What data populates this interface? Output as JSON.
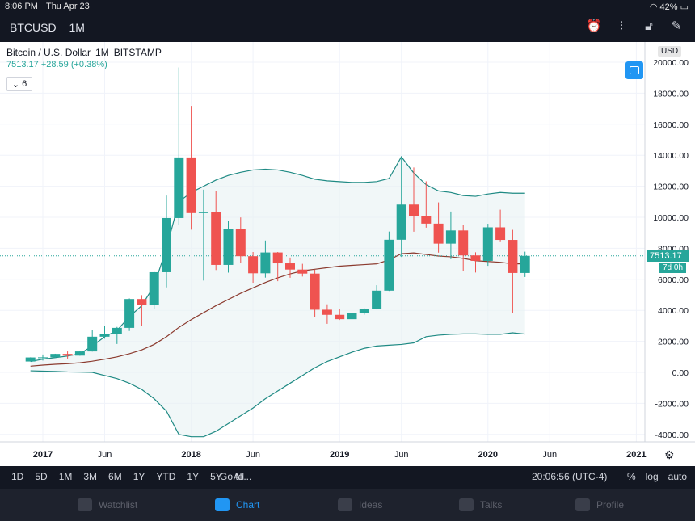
{
  "status": {
    "time": "8:06 PM",
    "date": "Thu Apr 23",
    "battery": "42%"
  },
  "header": {
    "symbol": "BTCUSD",
    "interval": "1M"
  },
  "toolbar_icons": [
    "alarm-icon",
    "indicators-icon",
    "lock-icon",
    "drawing-icon"
  ],
  "legend": {
    "title": "Bitcoin / U.S. Dollar",
    "interval": "1M",
    "exchange": "BITSTAMP",
    "last": "7513.17",
    "change": "+28.59 (+0.38%)",
    "indicator_count": "6"
  },
  "currency": "USD",
  "price_label": "7513.17",
  "time_label": "7d 0h",
  "range_buttons": [
    "1D",
    "5D",
    "1M",
    "3M",
    "6M",
    "1Y",
    "YTD",
    "1Y",
    "5Y",
    "All"
  ],
  "goto": "Go to...",
  "clock": "20:06:56 (UTC-4)",
  "options": [
    "%",
    "log",
    "auto"
  ],
  "tabs": [
    "Watchlist",
    "Chart",
    "Ideas",
    "Talks",
    "Profile"
  ],
  "colors": {
    "up": "#26a69a",
    "down": "#ef5350",
    "band": "#1f8a84",
    "ma": "#8b3a2e"
  },
  "chart_data": {
    "type": "candlestick",
    "y_ticks": [
      "20000.00",
      "18000.00",
      "16000.00",
      "14000.00",
      "12000.00",
      "10000.00",
      "8000.00",
      "6000.00",
      "4000.00",
      "2000.00",
      "0.00",
      "-2000.00",
      "-4000.00"
    ],
    "ylim": [
      -4500,
      20500
    ],
    "x_ticks": [
      "2017",
      "Jun",
      "2018",
      "Jun",
      "2019",
      "Jun",
      "2020",
      "Jun",
      "2021"
    ],
    "candles": [
      {
        "t": "2016-12",
        "o": 700,
        "h": 970,
        "l": 700,
        "c": 960
      },
      {
        "t": "2017-01",
        "o": 960,
        "h": 1150,
        "l": 760,
        "c": 970
      },
      {
        "t": "2017-02",
        "o": 970,
        "h": 1200,
        "l": 930,
        "c": 1190
      },
      {
        "t": "2017-03",
        "o": 1190,
        "h": 1350,
        "l": 890,
        "c": 1080
      },
      {
        "t": "2017-04",
        "o": 1080,
        "h": 1360,
        "l": 1070,
        "c": 1350
      },
      {
        "t": "2017-05",
        "o": 1350,
        "h": 2760,
        "l": 1340,
        "c": 2300
      },
      {
        "t": "2017-06",
        "o": 2300,
        "h": 3000,
        "l": 2170,
        "c": 2490
      },
      {
        "t": "2017-07",
        "o": 2490,
        "h": 2930,
        "l": 1830,
        "c": 2870
      },
      {
        "t": "2017-08",
        "o": 2870,
        "h": 4770,
        "l": 2670,
        "c": 4730
      },
      {
        "t": "2017-09",
        "o": 4730,
        "h": 4980,
        "l": 2980,
        "c": 4340
      },
      {
        "t": "2017-10",
        "o": 4340,
        "h": 6480,
        "l": 4110,
        "c": 6460
      },
      {
        "t": "2017-11",
        "o": 6460,
        "h": 11400,
        "l": 5480,
        "c": 9950
      },
      {
        "t": "2017-12",
        "o": 9950,
        "h": 19660,
        "l": 9500,
        "c": 13860
      },
      {
        "t": "2018-01",
        "o": 13860,
        "h": 17180,
        "l": 9200,
        "c": 10270
      },
      {
        "t": "2018-02",
        "o": 10270,
        "h": 11780,
        "l": 5920,
        "c": 10330
      },
      {
        "t": "2018-03",
        "o": 10330,
        "h": 11700,
        "l": 6600,
        "c": 6930
      },
      {
        "t": "2018-04",
        "o": 6930,
        "h": 9760,
        "l": 6430,
        "c": 9240
      },
      {
        "t": "2018-05",
        "o": 9240,
        "h": 9990,
        "l": 7030,
        "c": 7490
      },
      {
        "t": "2018-06",
        "o": 7490,
        "h": 7760,
        "l": 5780,
        "c": 6390
      },
      {
        "t": "2018-07",
        "o": 6390,
        "h": 8500,
        "l": 6110,
        "c": 7730
      },
      {
        "t": "2018-08",
        "o": 7730,
        "h": 7760,
        "l": 5880,
        "c": 7030
      },
      {
        "t": "2018-09",
        "o": 7030,
        "h": 7400,
        "l": 6100,
        "c": 6630
      },
      {
        "t": "2018-10",
        "o": 6630,
        "h": 7000,
        "l": 6180,
        "c": 6370
      },
      {
        "t": "2018-11",
        "o": 6370,
        "h": 6620,
        "l": 3550,
        "c": 4040
      },
      {
        "t": "2018-12",
        "o": 4040,
        "h": 4390,
        "l": 3130,
        "c": 3710
      },
      {
        "t": "2019-01",
        "o": 3710,
        "h": 4080,
        "l": 3380,
        "c": 3430
      },
      {
        "t": "2019-02",
        "o": 3430,
        "h": 4200,
        "l": 3390,
        "c": 3820
      },
      {
        "t": "2019-03",
        "o": 3820,
        "h": 4130,
        "l": 3720,
        "c": 4100
      },
      {
        "t": "2019-04",
        "o": 4100,
        "h": 5620,
        "l": 4060,
        "c": 5270
      },
      {
        "t": "2019-05",
        "o": 5270,
        "h": 9080,
        "l": 5250,
        "c": 8550
      },
      {
        "t": "2019-06",
        "o": 8550,
        "h": 13880,
        "l": 7440,
        "c": 10820
      },
      {
        "t": "2019-07",
        "o": 10820,
        "h": 13210,
        "l": 9070,
        "c": 10090
      },
      {
        "t": "2019-08",
        "o": 10090,
        "h": 12320,
        "l": 9330,
        "c": 9590
      },
      {
        "t": "2019-09",
        "o": 9590,
        "h": 10960,
        "l": 7720,
        "c": 8300
      },
      {
        "t": "2019-10",
        "o": 8300,
        "h": 10370,
        "l": 7300,
        "c": 9150
      },
      {
        "t": "2019-11",
        "o": 9150,
        "h": 9500,
        "l": 6520,
        "c": 7540
      },
      {
        "t": "2019-12",
        "o": 7540,
        "h": 7740,
        "l": 6440,
        "c": 7190
      },
      {
        "t": "2020-01",
        "o": 7190,
        "h": 9580,
        "l": 6870,
        "c": 9350
      },
      {
        "t": "2020-02",
        "o": 9350,
        "h": 10490,
        "l": 8450,
        "c": 8540
      },
      {
        "t": "2020-03",
        "o": 8540,
        "h": 9190,
        "l": 3850,
        "c": 6410
      },
      {
        "t": "2020-04",
        "o": 6410,
        "h": 7780,
        "l": 6150,
        "c": 7513
      }
    ],
    "bb_upper": [
      {
        "t": "2016-12",
        "v": 700
      },
      {
        "t": "2017-01",
        "v": 850
      },
      {
        "t": "2017-02",
        "v": 950
      },
      {
        "t": "2017-03",
        "v": 1050
      },
      {
        "t": "2017-04",
        "v": 1200
      },
      {
        "t": "2017-05",
        "v": 1700
      },
      {
        "t": "2017-06",
        "v": 2300
      },
      {
        "t": "2017-07",
        "v": 2700
      },
      {
        "t": "2017-08",
        "v": 3600
      },
      {
        "t": "2017-09",
        "v": 4300
      },
      {
        "t": "2017-10",
        "v": 5600
      },
      {
        "t": "2017-11",
        "v": 8000
      },
      {
        "t": "2017-12",
        "v": 11000
      },
      {
        "t": "2018-01",
        "v": 11600
      },
      {
        "t": "2018-02",
        "v": 12000
      },
      {
        "t": "2018-03",
        "v": 12400
      },
      {
        "t": "2018-04",
        "v": 12700
      },
      {
        "t": "2018-05",
        "v": 12900
      },
      {
        "t": "2018-06",
        "v": 13050
      },
      {
        "t": "2018-07",
        "v": 13100
      },
      {
        "t": "2018-08",
        "v": 13050
      },
      {
        "t": "2018-09",
        "v": 12900
      },
      {
        "t": "2018-10",
        "v": 12700
      },
      {
        "t": "2018-11",
        "v": 12450
      },
      {
        "t": "2018-12",
        "v": 12350
      },
      {
        "t": "2019-01",
        "v": 12300
      },
      {
        "t": "2019-02",
        "v": 12250
      },
      {
        "t": "2019-03",
        "v": 12250
      },
      {
        "t": "2019-04",
        "v": 12300
      },
      {
        "t": "2019-05",
        "v": 12500
      },
      {
        "t": "2019-06",
        "v": 13900
      },
      {
        "t": "2019-07",
        "v": 12850
      },
      {
        "t": "2019-08",
        "v": 12100
      },
      {
        "t": "2019-09",
        "v": 11700
      },
      {
        "t": "2019-10",
        "v": 11600
      },
      {
        "t": "2019-11",
        "v": 11400
      },
      {
        "t": "2019-12",
        "v": 11350
      },
      {
        "t": "2020-01",
        "v": 11500
      },
      {
        "t": "2020-02",
        "v": 11600
      },
      {
        "t": "2020-03",
        "v": 11550
      },
      {
        "t": "2020-04",
        "v": 11550
      }
    ],
    "bb_lower": [
      {
        "t": "2016-12",
        "v": 100
      },
      {
        "t": "2017-01",
        "v": 80
      },
      {
        "t": "2017-02",
        "v": 60
      },
      {
        "t": "2017-03",
        "v": 30
      },
      {
        "t": "2017-04",
        "v": 20
      },
      {
        "t": "2017-05",
        "v": 0
      },
      {
        "t": "2017-06",
        "v": -200
      },
      {
        "t": "2017-07",
        "v": -400
      },
      {
        "t": "2017-08",
        "v": -700
      },
      {
        "t": "2017-09",
        "v": -1100
      },
      {
        "t": "2017-10",
        "v": -1700
      },
      {
        "t": "2017-11",
        "v": -2500
      },
      {
        "t": "2017-12",
        "v": -4000
      },
      {
        "t": "2018-01",
        "v": -4150
      },
      {
        "t": "2018-02",
        "v": -4150
      },
      {
        "t": "2018-03",
        "v": -3800
      },
      {
        "t": "2018-04",
        "v": -3300
      },
      {
        "t": "2018-05",
        "v": -2800
      },
      {
        "t": "2018-06",
        "v": -2300
      },
      {
        "t": "2018-07",
        "v": -1700
      },
      {
        "t": "2018-08",
        "v": -1200
      },
      {
        "t": "2018-09",
        "v": -700
      },
      {
        "t": "2018-10",
        "v": -200
      },
      {
        "t": "2018-11",
        "v": 300
      },
      {
        "t": "2018-12",
        "v": 700
      },
      {
        "t": "2019-01",
        "v": 1000
      },
      {
        "t": "2019-02",
        "v": 1300
      },
      {
        "t": "2019-03",
        "v": 1550
      },
      {
        "t": "2019-04",
        "v": 1700
      },
      {
        "t": "2019-05",
        "v": 1750
      },
      {
        "t": "2019-06",
        "v": 1800
      },
      {
        "t": "2019-07",
        "v": 1900
      },
      {
        "t": "2019-08",
        "v": 2300
      },
      {
        "t": "2019-09",
        "v": 2400
      },
      {
        "t": "2019-10",
        "v": 2450
      },
      {
        "t": "2019-11",
        "v": 2480
      },
      {
        "t": "2019-12",
        "v": 2480
      },
      {
        "t": "2020-01",
        "v": 2450
      },
      {
        "t": "2020-02",
        "v": 2450
      },
      {
        "t": "2020-03",
        "v": 2550
      },
      {
        "t": "2020-04",
        "v": 2470
      }
    ],
    "ma": [
      {
        "t": "2016-12",
        "v": 400
      },
      {
        "t": "2017-01",
        "v": 470
      },
      {
        "t": "2017-02",
        "v": 520
      },
      {
        "t": "2017-03",
        "v": 560
      },
      {
        "t": "2017-04",
        "v": 620
      },
      {
        "t": "2017-05",
        "v": 720
      },
      {
        "t": "2017-06",
        "v": 850
      },
      {
        "t": "2017-07",
        "v": 1000
      },
      {
        "t": "2017-08",
        "v": 1200
      },
      {
        "t": "2017-09",
        "v": 1450
      },
      {
        "t": "2017-10",
        "v": 1800
      },
      {
        "t": "2017-11",
        "v": 2300
      },
      {
        "t": "2017-12",
        "v": 2900
      },
      {
        "t": "2018-01",
        "v": 3400
      },
      {
        "t": "2018-02",
        "v": 3850
      },
      {
        "t": "2018-03",
        "v": 4300
      },
      {
        "t": "2018-04",
        "v": 4700
      },
      {
        "t": "2018-05",
        "v": 5100
      },
      {
        "t": "2018-06",
        "v": 5450
      },
      {
        "t": "2018-07",
        "v": 5800
      },
      {
        "t": "2018-08",
        "v": 6100
      },
      {
        "t": "2018-09",
        "v": 6350
      },
      {
        "t": "2018-10",
        "v": 6550
      },
      {
        "t": "2018-11",
        "v": 6650
      },
      {
        "t": "2018-12",
        "v": 6750
      },
      {
        "t": "2019-01",
        "v": 6850
      },
      {
        "t": "2019-02",
        "v": 6900
      },
      {
        "t": "2019-03",
        "v": 6950
      },
      {
        "t": "2019-04",
        "v": 7000
      },
      {
        "t": "2019-05",
        "v": 7250
      },
      {
        "t": "2019-06",
        "v": 7650
      },
      {
        "t": "2019-07",
        "v": 7700
      },
      {
        "t": "2019-08",
        "v": 7600
      },
      {
        "t": "2019-09",
        "v": 7500
      },
      {
        "t": "2019-10",
        "v": 7450
      },
      {
        "t": "2019-11",
        "v": 7350
      },
      {
        "t": "2019-12",
        "v": 7200
      },
      {
        "t": "2020-01",
        "v": 7150
      },
      {
        "t": "2020-02",
        "v": 7100
      },
      {
        "t": "2020-03",
        "v": 7000
      },
      {
        "t": "2020-04",
        "v": 7000
      }
    ]
  }
}
